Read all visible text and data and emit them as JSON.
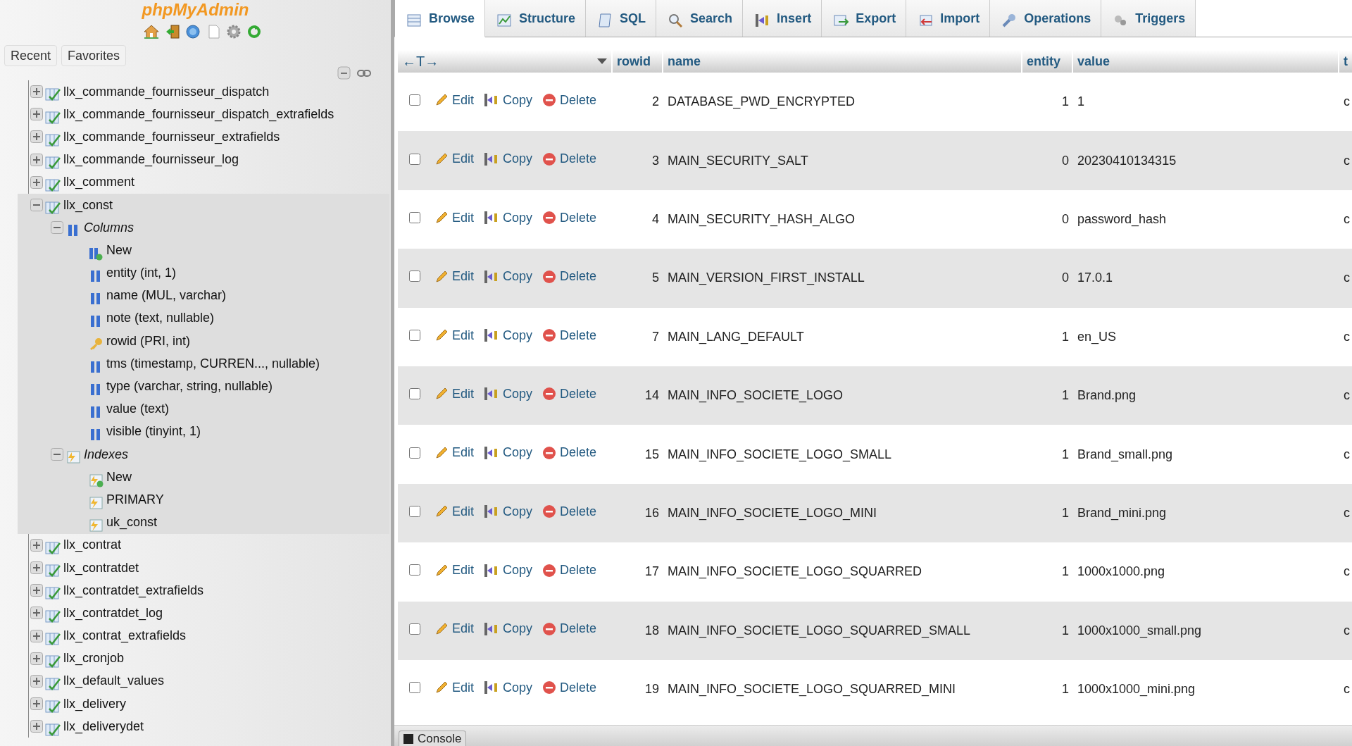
{
  "logo": {
    "text": "phpMyAdmin"
  },
  "sidebar_tabs": [
    {
      "label": "Recent"
    },
    {
      "label": "Favorites"
    }
  ],
  "tree": [
    {
      "label": "llx_commande_fournisseur_dispatch",
      "kind": "table",
      "expanded": false
    },
    {
      "label": "llx_commande_fournisseur_dispatch_extrafields",
      "kind": "table",
      "expanded": false
    },
    {
      "label": "llx_commande_fournisseur_extrafields",
      "kind": "table",
      "expanded": false
    },
    {
      "label": "llx_commande_fournisseur_log",
      "kind": "table",
      "expanded": false
    },
    {
      "label": "llx_comment",
      "kind": "table",
      "expanded": false
    },
    {
      "label": "llx_const",
      "kind": "table",
      "expanded": true,
      "children": [
        {
          "label": "Columns",
          "kind": "columns_group",
          "expanded": true,
          "children": [
            {
              "label": "New",
              "kind": "new_column"
            },
            {
              "label": "entity (int, 1)",
              "kind": "column"
            },
            {
              "label": "name (MUL, varchar)",
              "kind": "column"
            },
            {
              "label": "note (text, nullable)",
              "kind": "column"
            },
            {
              "label": "rowid (PRI, int)",
              "kind": "key"
            },
            {
              "label": "tms (timestamp, CURREN..., nullable)",
              "kind": "column"
            },
            {
              "label": "type (varchar, string, nullable)",
              "kind": "column"
            },
            {
              "label": "value (text)",
              "kind": "column"
            },
            {
              "label": "visible (tinyint, 1)",
              "kind": "column"
            }
          ]
        },
        {
          "label": "Indexes",
          "kind": "indexes_group",
          "expanded": true,
          "children": [
            {
              "label": "New",
              "kind": "new_index"
            },
            {
              "label": "PRIMARY",
              "kind": "index"
            },
            {
              "label": "uk_const",
              "kind": "index"
            }
          ]
        }
      ]
    },
    {
      "label": "llx_contrat",
      "kind": "table",
      "expanded": false
    },
    {
      "label": "llx_contratdet",
      "kind": "table",
      "expanded": false
    },
    {
      "label": "llx_contratdet_extrafields",
      "kind": "table",
      "expanded": false
    },
    {
      "label": "llx_contratdet_log",
      "kind": "table",
      "expanded": false
    },
    {
      "label": "llx_contrat_extrafields",
      "kind": "table",
      "expanded": false
    },
    {
      "label": "llx_cronjob",
      "kind": "table",
      "expanded": false
    },
    {
      "label": "llx_default_values",
      "kind": "table",
      "expanded": false
    },
    {
      "label": "llx_delivery",
      "kind": "table",
      "expanded": false
    },
    {
      "label": "llx_deliverydet",
      "kind": "table",
      "expanded": false
    }
  ],
  "tabs": [
    {
      "label": "Browse",
      "selected": true
    },
    {
      "label": "Structure",
      "selected": false
    },
    {
      "label": "SQL",
      "selected": false
    },
    {
      "label": "Search",
      "selected": false
    },
    {
      "label": "Insert",
      "selected": false
    },
    {
      "label": "Export",
      "selected": false
    },
    {
      "label": "Import",
      "selected": false
    },
    {
      "label": "Operations",
      "selected": false
    },
    {
      "label": "Triggers",
      "selected": false
    }
  ],
  "table": {
    "column_toggle": "←T→",
    "columns": [
      "rowid",
      "name",
      "entity",
      "value",
      "t"
    ],
    "rows": [
      {
        "checked": false,
        "actions": [
          "Edit",
          "Copy",
          "Delete"
        ],
        "cells": [
          "2",
          "DATABASE_PWD_ENCRYPTED",
          "1",
          "1",
          "c"
        ]
      },
      {
        "checked": false,
        "actions": [
          "Edit",
          "Copy",
          "Delete"
        ],
        "cells": [
          "3",
          "MAIN_SECURITY_SALT",
          "0",
          "20230410134315",
          "c"
        ]
      },
      {
        "checked": false,
        "actions": [
          "Edit",
          "Copy",
          "Delete"
        ],
        "cells": [
          "4",
          "MAIN_SECURITY_HASH_ALGO",
          "0",
          "password_hash",
          "c"
        ]
      },
      {
        "checked": false,
        "actions": [
          "Edit",
          "Copy",
          "Delete"
        ],
        "cells": [
          "5",
          "MAIN_VERSION_FIRST_INSTALL",
          "0",
          "17.0.1",
          "c"
        ]
      },
      {
        "checked": false,
        "actions": [
          "Edit",
          "Copy",
          "Delete"
        ],
        "cells": [
          "7",
          "MAIN_LANG_DEFAULT",
          "1",
          "en_US",
          "c"
        ]
      },
      {
        "checked": false,
        "actions": [
          "Edit",
          "Copy",
          "Delete"
        ],
        "cells": [
          "14",
          "MAIN_INFO_SOCIETE_LOGO",
          "1",
          "Brand.png",
          "c"
        ]
      },
      {
        "checked": false,
        "actions": [
          "Edit",
          "Copy",
          "Delete"
        ],
        "cells": [
          "15",
          "MAIN_INFO_SOCIETE_LOGO_SMALL",
          "1",
          "Brand_small.png",
          "c"
        ]
      },
      {
        "checked": false,
        "actions": [
          "Edit",
          "Copy",
          "Delete"
        ],
        "cells": [
          "16",
          "MAIN_INFO_SOCIETE_LOGO_MINI",
          "1",
          "Brand_mini.png",
          "c"
        ]
      },
      {
        "checked": false,
        "actions": [
          "Edit",
          "Copy",
          "Delete"
        ],
        "cells": [
          "17",
          "MAIN_INFO_SOCIETE_LOGO_SQUARRED",
          "1",
          "1000x1000.png",
          "c"
        ]
      },
      {
        "checked": false,
        "actions": [
          "Edit",
          "Copy",
          "Delete"
        ],
        "cells": [
          "18",
          "MAIN_INFO_SOCIETE_LOGO_SQUARRED_SMALL",
          "1",
          "1000x1000_small.png",
          "c"
        ]
      },
      {
        "checked": false,
        "actions": [
          "Edit",
          "Copy",
          "Delete"
        ],
        "cells": [
          "19",
          "MAIN_INFO_SOCIETE_LOGO_SQUARRED_MINI",
          "1",
          "1000x1000_mini.png",
          "c"
        ]
      }
    ]
  },
  "console": {
    "label": "Console"
  }
}
